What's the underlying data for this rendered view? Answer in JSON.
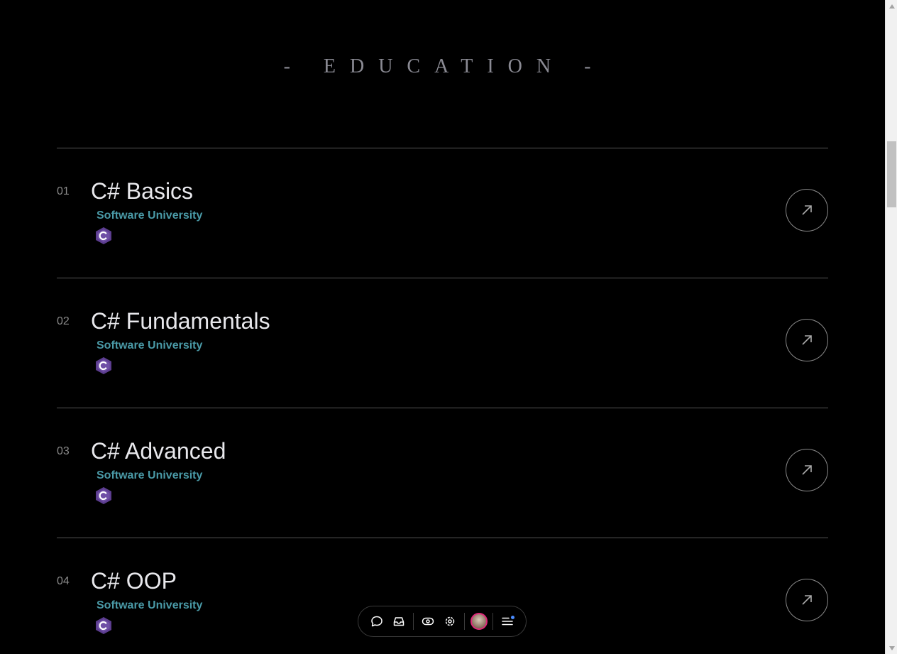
{
  "section": {
    "title": "- EDUCATION -"
  },
  "items": [
    {
      "number": "01",
      "title": "C# Basics",
      "school": "Software University",
      "logo_icon": "csharp-icon"
    },
    {
      "number": "02",
      "title": "C# Fundamentals",
      "school": "Software University",
      "logo_icon": "csharp-icon"
    },
    {
      "number": "03",
      "title": "C# Advanced",
      "school": "Software University",
      "logo_icon": "csharp-icon"
    },
    {
      "number": "04",
      "title": "C# OOP",
      "school": "Software University",
      "logo_icon": "csharp-icon"
    }
  ],
  "toolbar": {
    "icons": [
      "comment-icon",
      "inbox-icon",
      "eye-icon",
      "settings-icon",
      "avatar",
      "menu-icon"
    ]
  },
  "colors": {
    "background": "#000000",
    "title": "#8a8a93",
    "item_title": "#e8e8ec",
    "school": "#4a9aa7",
    "csharp_logo": "#5c3d8f",
    "avatar_ring": "#e0287a",
    "notification_dot": "#4a8cff"
  }
}
